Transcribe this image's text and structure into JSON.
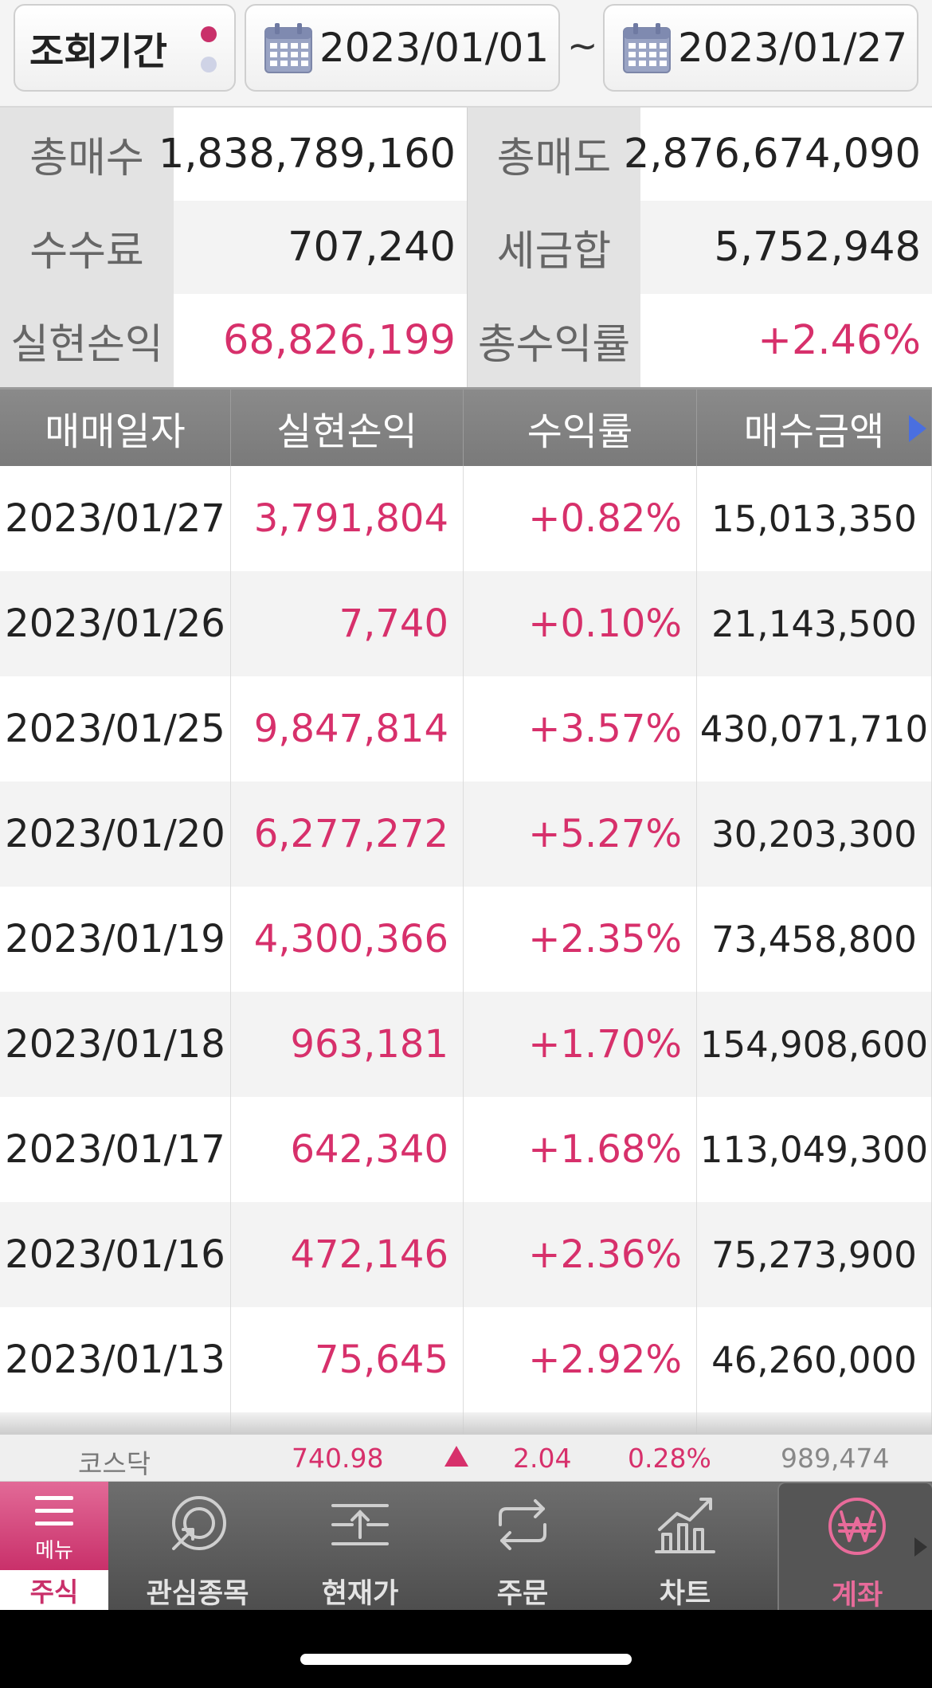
{
  "filter": {
    "period_label": "조회기간",
    "start_date": "2023/01/01",
    "separator": "~",
    "end_date": "2023/01/27"
  },
  "summary": {
    "rows": [
      {
        "label1": "총매수",
        "value1": "1,838,789,160",
        "label2": "총매도",
        "value2": "2,876,674,090"
      },
      {
        "label1": "수수료",
        "value1": "707,240",
        "label2": "세금합",
        "value2": "5,752,948"
      },
      {
        "label1": "실현손익",
        "value1": "68,826,199",
        "label2": "총수익률",
        "value2": "+2.46%"
      }
    ]
  },
  "table": {
    "headers": [
      "매매일자",
      "실현손익",
      "수익률",
      "매수금액"
    ],
    "rows": [
      {
        "date": "2023/01/27",
        "profit": "3,791,804",
        "rate": "+0.82%",
        "buy": "15,013,350"
      },
      {
        "date": "2023/01/26",
        "profit": "7,740",
        "rate": "+0.10%",
        "buy": "21,143,500"
      },
      {
        "date": "2023/01/25",
        "profit": "9,847,814",
        "rate": "+3.57%",
        "buy": "430,071,710"
      },
      {
        "date": "2023/01/20",
        "profit": "6,277,272",
        "rate": "+5.27%",
        "buy": "30,203,300"
      },
      {
        "date": "2023/01/19",
        "profit": "4,300,366",
        "rate": "+2.35%",
        "buy": "73,458,800"
      },
      {
        "date": "2023/01/18",
        "profit": "963,181",
        "rate": "+1.70%",
        "buy": "154,908,600"
      },
      {
        "date": "2023/01/17",
        "profit": "642,340",
        "rate": "+1.68%",
        "buy": "113,049,300"
      },
      {
        "date": "2023/01/16",
        "profit": "472,146",
        "rate": "+2.36%",
        "buy": "75,273,900"
      },
      {
        "date": "2023/01/13",
        "profit": "75,645",
        "rate": "+2.92%",
        "buy": "46,260,000"
      }
    ]
  },
  "ticker": {
    "name": "코스닥",
    "price": "740.98",
    "change": "2.04",
    "rate": "0.28%",
    "volume": "989,474"
  },
  "nav": {
    "menu_label": "메뉴",
    "menu_sub": "주식",
    "items": [
      {
        "label": "관심종목",
        "icon": "watchlist-icon"
      },
      {
        "label": "현재가",
        "icon": "current-price-icon"
      },
      {
        "label": "주문",
        "icon": "order-icon"
      },
      {
        "label": "차트",
        "icon": "chart-icon"
      },
      {
        "label": "계좌",
        "icon": "won-icon"
      }
    ]
  },
  "colors": {
    "accent_pink": "#d7306b",
    "header_gray": "#808080",
    "scroll_arrow_blue": "#4a6fe0"
  }
}
